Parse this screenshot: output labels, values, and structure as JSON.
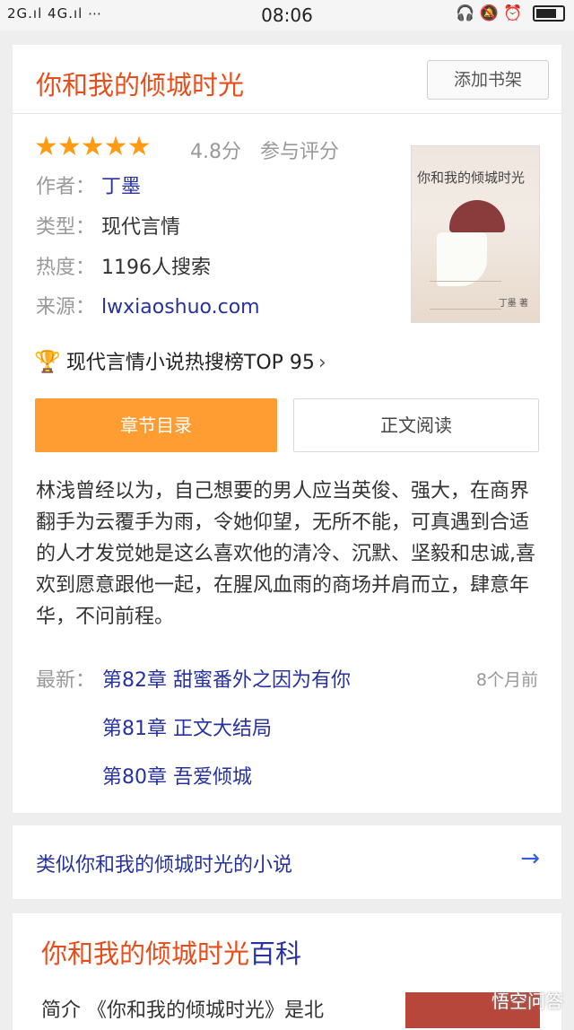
{
  "status_bar": {
    "signal": "2G.ıl 4G.ıl  ⋯",
    "time": "08:06",
    "icons": "🎧 🔕 ⏰"
  },
  "book": {
    "title": "你和我的倾城时光",
    "add_shelf": "添加书架",
    "stars": "★★★★★",
    "rating": "4.8分",
    "rate_link": "参与评分",
    "author_label": "作者：",
    "author": "丁墨",
    "type_label": "类型：",
    "type": "现代言情",
    "heat_label": "热度：",
    "heat": "1196人搜索",
    "source_label": "来源：",
    "source": "lwxiaoshuo.com",
    "rank": "现代言情小说热搜榜TOP 95",
    "btn_toc": "章节目录",
    "btn_read": "正文阅读",
    "description": "林浅曾经以为，自己想要的男人应当英俊、强大，在商界翻手为云覆手为雨，令她仰望，无所不能，可真遇到合适的人才发觉她是这么喜欢他的清冷、沉默、坚毅和忠诚,喜欢到愿意跟他一起，在腥风血雨的商场并肩而立，肆意年华，不问前程。",
    "latest_label": "最新：",
    "latest_time": "8个月前",
    "chapters": [
      "第82章 甜蜜番外之因为有你",
      "第81章 正文大结局",
      "第80章 吾爱倾城"
    ]
  },
  "similar": {
    "label": "类似你和我的倾城时光的小说"
  },
  "baike": {
    "title_part1": "你和我的倾城时光",
    "title_part2": "百科",
    "snippet": "简介 《你和我的倾城时光》是北"
  },
  "watermark": "悟空问答",
  "colors": {
    "accent_orange": "#ff9c32",
    "title_red": "#e84e1b",
    "link_blue": "#2732a0",
    "star": "#ff9a13"
  }
}
